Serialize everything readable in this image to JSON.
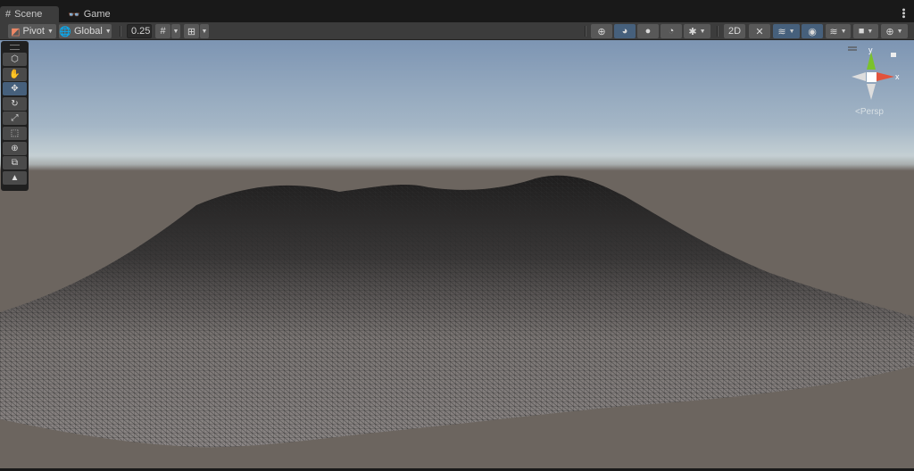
{
  "tabs": [
    {
      "label": "Scene",
      "icon": "grid-icon",
      "active": true
    },
    {
      "label": "Game",
      "icon": "gamepad-icon",
      "active": false
    }
  ],
  "toolbar": {
    "pivot": "Pivot",
    "space": "Global",
    "snap_value": "0.25"
  },
  "tools": [
    "view-tool",
    "hand-tool",
    "move-tool",
    "rotate-tool",
    "scale-tool",
    "rect-tool",
    "transform-tool",
    "custom-tool",
    "terrain-tool"
  ],
  "gizmo": {
    "y": "y",
    "x": "x",
    "projection": "Persp"
  },
  "colors": {
    "accent": "#46607c",
    "x_axis": "#e2533c",
    "y_axis": "#7bc22b"
  }
}
